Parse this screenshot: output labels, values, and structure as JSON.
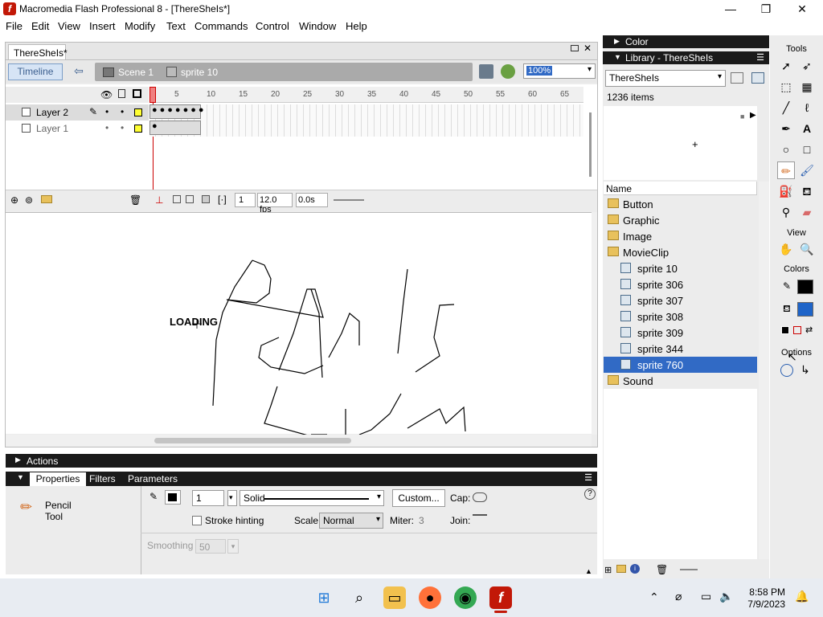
{
  "window": {
    "title": "Macromedia Flash Professional 8 - [ThereSheIs*]",
    "app_badge": "f",
    "minimize_glyph": "—",
    "restore_glyph": "❐",
    "close_glyph": "✕"
  },
  "menu": [
    "File",
    "Edit",
    "View",
    "Insert",
    "Modify",
    "Text",
    "Commands",
    "Control",
    "Window",
    "Help"
  ],
  "document": {
    "tab": "ThereSheIs*",
    "timeline_button": "Timeline",
    "breadcrumb": {
      "scene": "Scene 1",
      "symbol": "sprite 10"
    },
    "zoom": "100%",
    "close_glyph": "✕"
  },
  "timeline": {
    "layers": [
      {
        "name": "Layer 2",
        "selected": true
      },
      {
        "name": "Layer 1",
        "selected": false
      }
    ],
    "ruler_ticks": [
      "5",
      "10",
      "15",
      "20",
      "25",
      "30",
      "35",
      "40",
      "45",
      "50",
      "55",
      "60",
      "65"
    ],
    "current_frame": "1",
    "fps": "12.0 fps",
    "elapsed": "0.0s"
  },
  "stage": {
    "text": "LOADING"
  },
  "actions_panel": {
    "label": "Actions"
  },
  "properties": {
    "tabs": [
      "Properties",
      "Filters",
      "Parameters"
    ],
    "tool_name": "Pencil",
    "tool_type": "Tool",
    "stroke_height": "1",
    "stroke_style": "Solid",
    "custom_button": "Custom...",
    "cap_label": "Cap:",
    "stroke_hinting_label": "Stroke hinting",
    "scale_label": "Scale:",
    "scale_value": "Normal",
    "miter_label": "Miter:",
    "miter_value": "3",
    "join_label": "Join:",
    "smoothing_label": "Smoothing",
    "smoothing_value": "50",
    "help_glyph": "?"
  },
  "right_panel": {
    "color_header": "Color",
    "library_header": "Library - ThereSheIs",
    "library_select": "ThereSheIs",
    "item_count": "1236 items",
    "name_column": "Name",
    "items": [
      {
        "label": "Button",
        "type": "folder"
      },
      {
        "label": "Graphic",
        "type": "folder"
      },
      {
        "label": "Image",
        "type": "folder"
      },
      {
        "label": "MovieClip",
        "type": "folder"
      },
      {
        "label": "sprite 10",
        "type": "symbol"
      },
      {
        "label": "sprite 306",
        "type": "symbol"
      },
      {
        "label": "sprite 307",
        "type": "symbol"
      },
      {
        "label": "sprite 308",
        "type": "symbol"
      },
      {
        "label": "sprite 309",
        "type": "symbol"
      },
      {
        "label": "sprite 344",
        "type": "symbol"
      },
      {
        "label": "sprite 760",
        "type": "symbol",
        "selected": true
      },
      {
        "label": "Sound",
        "type": "folder"
      }
    ]
  },
  "tools": {
    "header": "Tools",
    "view_header": "View",
    "colors_header": "Colors",
    "options_header": "Options",
    "selected_tool": "pencil"
  },
  "taskbar": {
    "time": "8:58 PM",
    "date": "7/9/2023"
  },
  "colors": {
    "accent": "#316ac5",
    "panel_header": "#1a1a1a",
    "stroke_color": "#000000",
    "fill_color": "#1e64c8"
  }
}
